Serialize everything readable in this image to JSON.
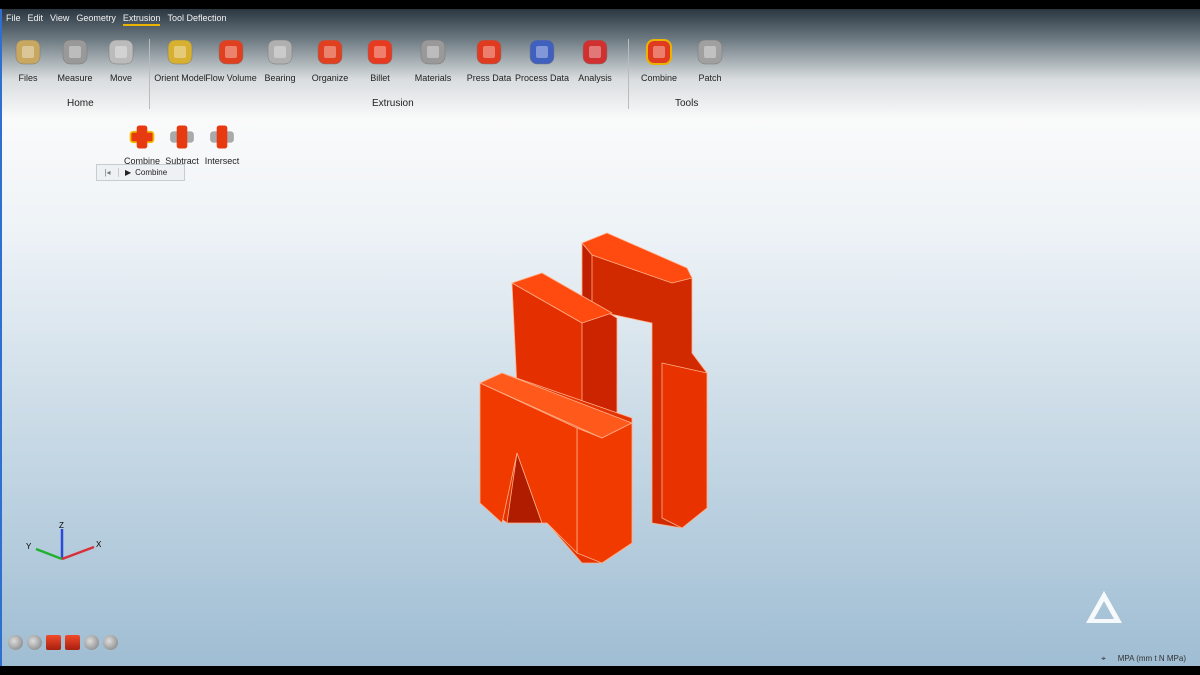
{
  "menu": [
    "File",
    "Edit",
    "View",
    "Geometry",
    "Extrusion",
    "Tool Deflection"
  ],
  "active_menu": "Extrusion",
  "ribbon": {
    "home": {
      "label": "Home",
      "tools": [
        "Files",
        "Measure",
        "Move"
      ]
    },
    "extrusion": {
      "label": "Extrusion",
      "tools": [
        "Orient Model",
        "Flow Volume",
        "Bearing",
        "Organize",
        "Billet",
        "Materials",
        "Press Data",
        "Process Data",
        "Analysis"
      ]
    },
    "tools": {
      "label": "Tools",
      "tools": [
        "Combine",
        "Patch"
      ]
    }
  },
  "subtools": [
    "Combine",
    "Subtract",
    "Intersect"
  ],
  "breadcrumb": {
    "current": "Combine"
  },
  "axes": {
    "x": "X",
    "y": "Y",
    "z": "Z"
  },
  "status": {
    "units": "MPA (mm t N MPa)"
  },
  "colors": {
    "model": "#f03a00",
    "accent": "#e8b400"
  }
}
